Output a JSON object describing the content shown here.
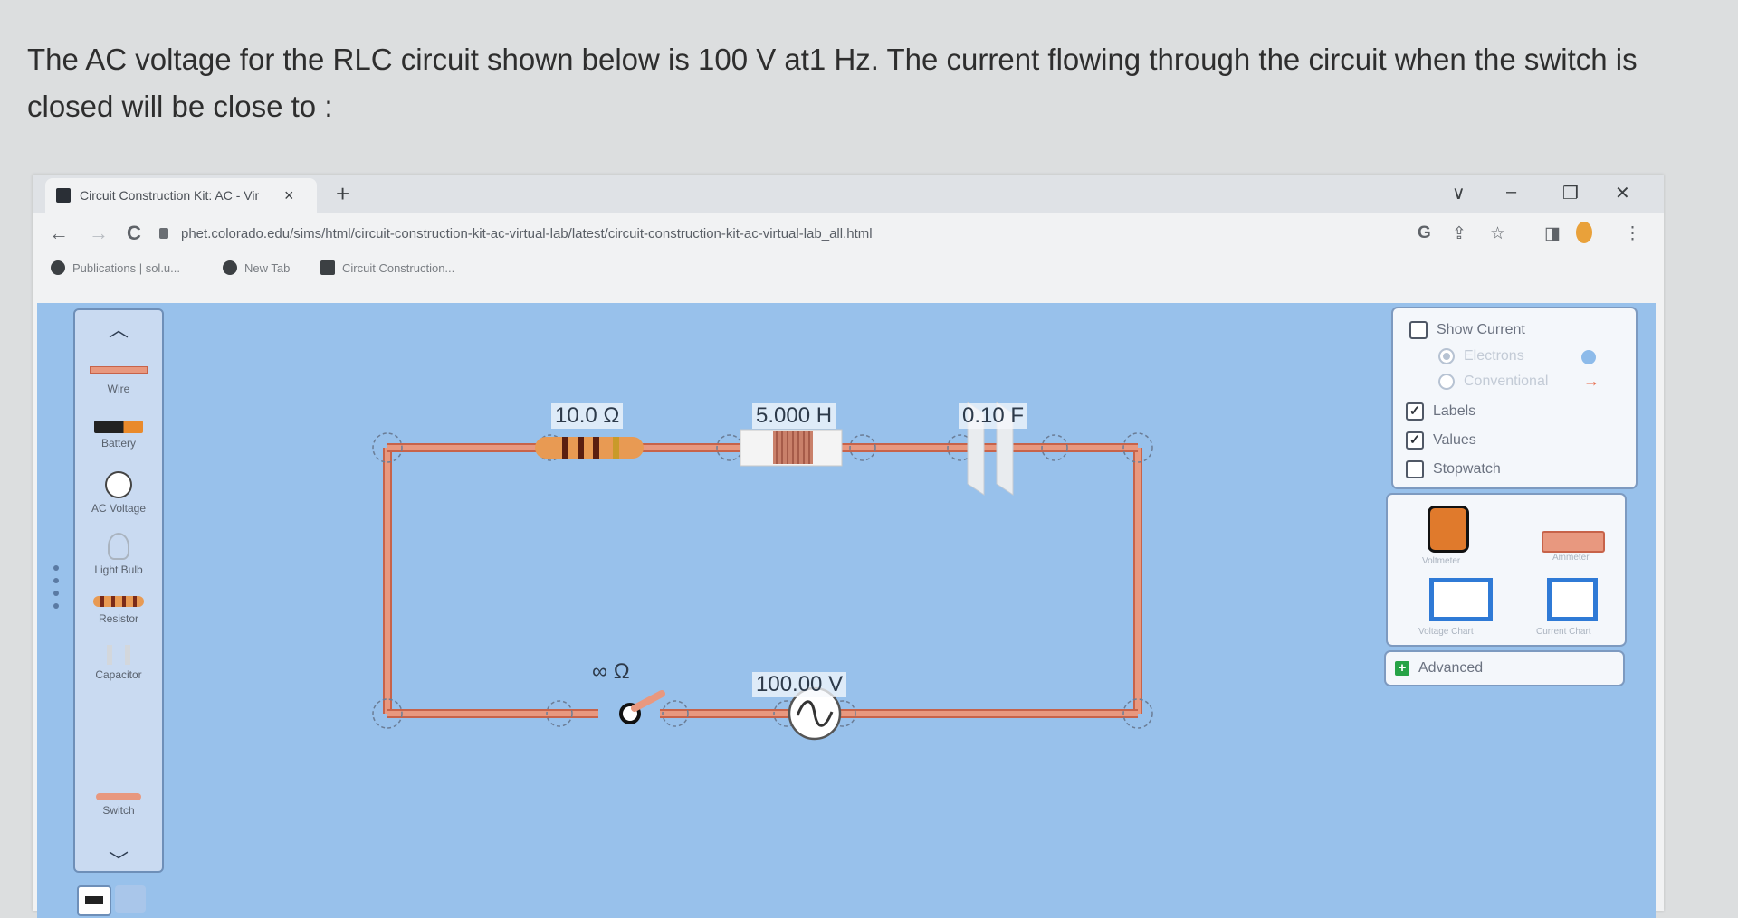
{
  "question": {
    "text": "The AC voltage for the RLC circuit shown below is 100 V at1 Hz. The current flowing through the circuit when the switch is closed will be close to :"
  },
  "browser": {
    "tab_title": "Circuit Construction Kit: AC - Vir",
    "tab_close": "×",
    "new_tab": "+",
    "url": "phet.colorado.edu/sims/html/circuit-construction-kit-ac-virtual-lab/latest/circuit-construction-kit-ac-virtual-lab_all.html",
    "back": "←",
    "forward": "→",
    "reload": "C",
    "window_controls": {
      "dropdown": "∨",
      "minimize": "–",
      "restore": "❐",
      "close": "✕"
    },
    "toolbar_icons": {
      "google": "G",
      "share": "⇪",
      "bookmark_star": "☆",
      "sidepanel": "◨",
      "menu": "⋮"
    },
    "bookmarks": [
      {
        "label": "Publications | sol.u..."
      },
      {
        "label": "New Tab"
      },
      {
        "label": "Circuit Construction..."
      }
    ]
  },
  "toolbox": {
    "up_arrow": "︿",
    "down_arrow": "﹀",
    "items": [
      {
        "label": "Wire"
      },
      {
        "label": "Battery"
      },
      {
        "label": "AC Voltage"
      },
      {
        "label": "Light Bulb"
      },
      {
        "label": "Resistor"
      },
      {
        "label": "Capacitor"
      },
      {
        "label": "Switch"
      }
    ]
  },
  "circuit": {
    "resistor_value": "10.0 Ω",
    "inductor_value": "5.000 H",
    "capacitor_value": "0.10 F",
    "switch_value": "∞ Ω",
    "source_value": "100.00 V"
  },
  "display_panel": {
    "show_current": {
      "label": "Show Current",
      "checked": false
    },
    "electrons": {
      "label": "Electrons",
      "selected": true
    },
    "conventional": {
      "label": "Conventional",
      "selected": false
    },
    "labels": {
      "label": "Labels",
      "checked": true
    },
    "values": {
      "label": "Values",
      "checked": true
    },
    "stopwatch": {
      "label": "Stopwatch",
      "checked": false
    },
    "checkmark": "✓"
  },
  "tools_panel": {
    "voltmeter": "Voltmeter",
    "ammeter": "Ammeter",
    "voltage_chart": "Voltage Chart",
    "current_chart": "Current Chart"
  },
  "advanced": {
    "label": "Advanced",
    "icon": "+"
  },
  "colors": {
    "sim_background": "#98c1eb",
    "wire": "#e8987f",
    "wire_edge": "#c7634a"
  }
}
